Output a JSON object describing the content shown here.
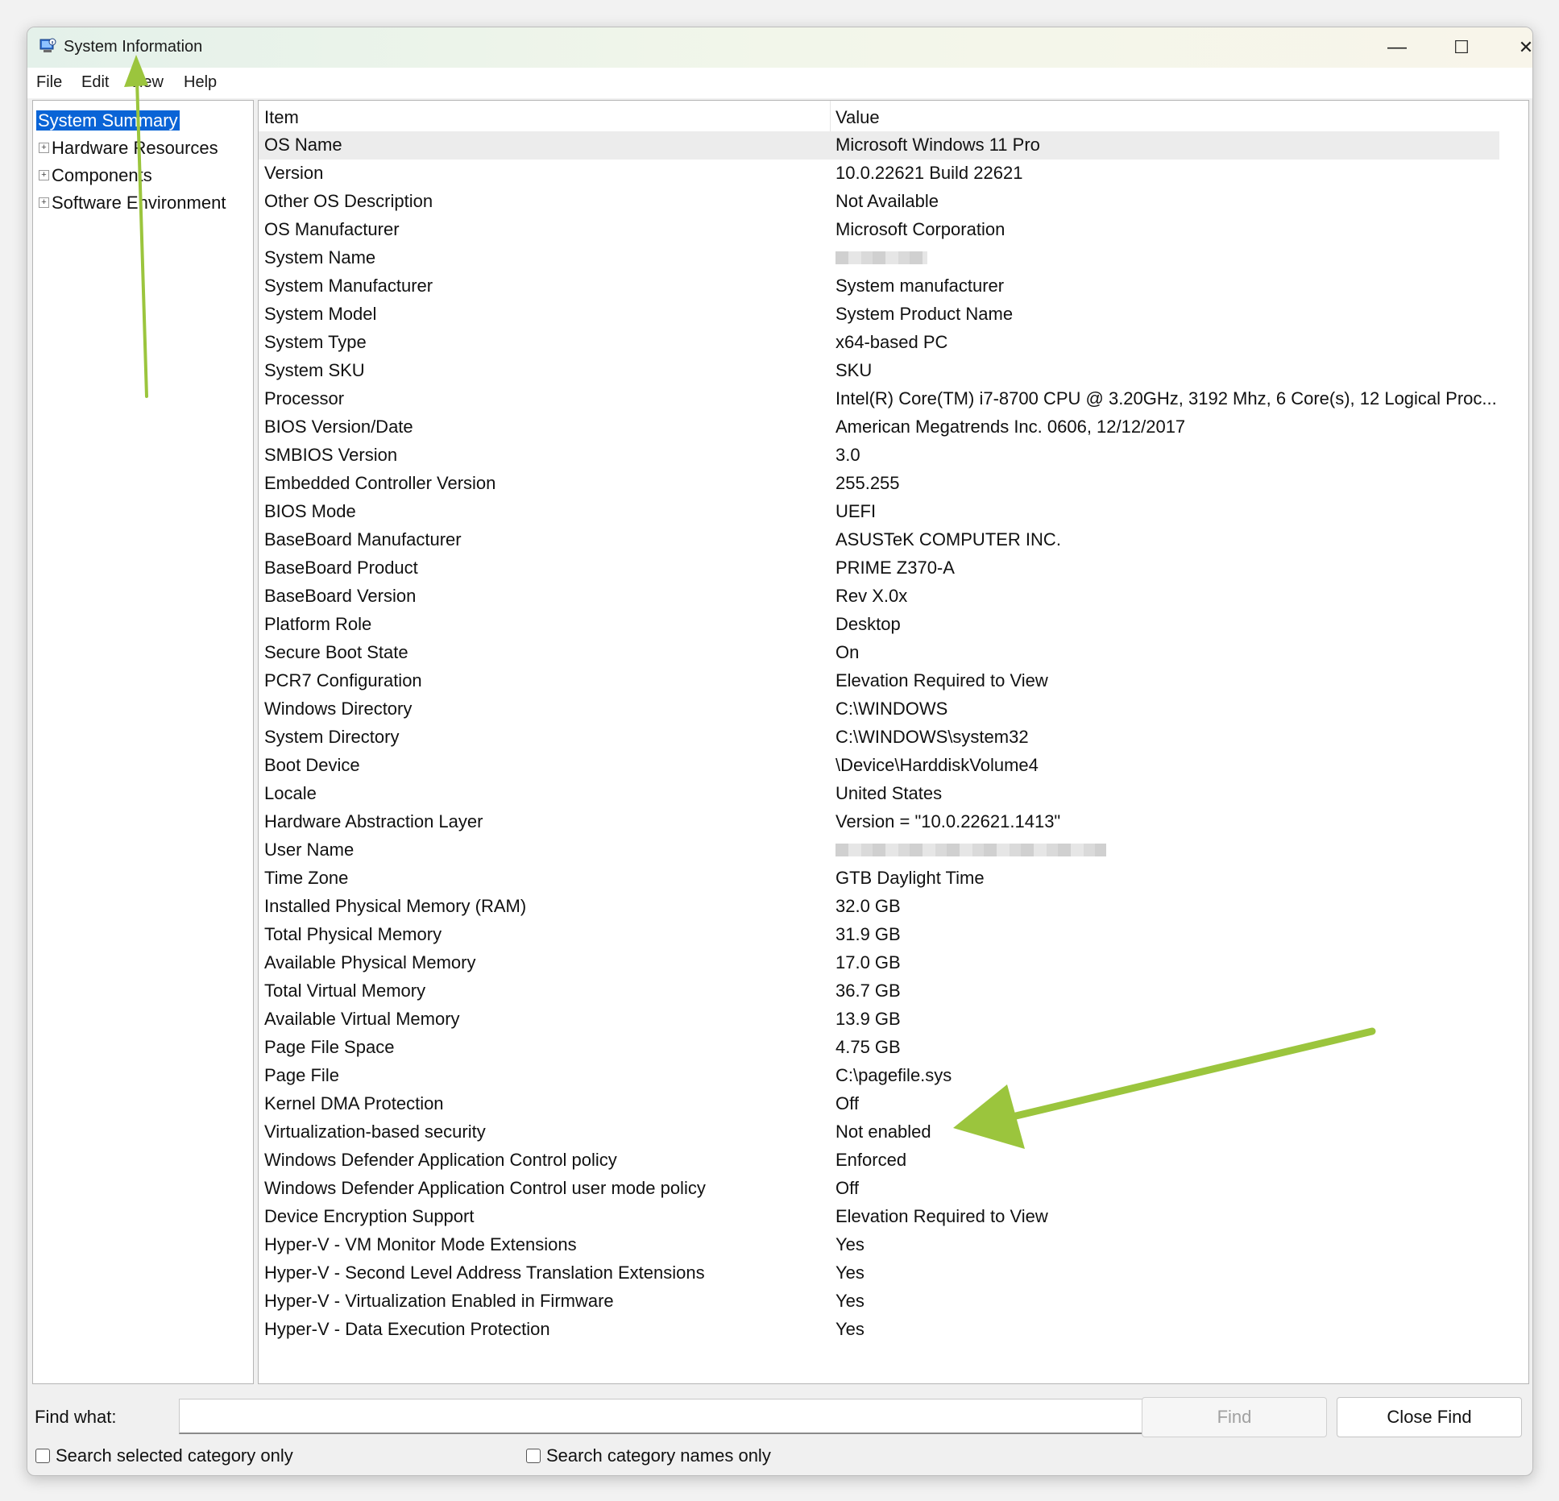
{
  "window": {
    "title": "System Information",
    "minimize_glyph": "—",
    "maximize_glyph": "☐",
    "close_glyph": "✕"
  },
  "menu": [
    "File",
    "Edit",
    "View",
    "Help"
  ],
  "tree": [
    {
      "label": "System Summary",
      "selected": true,
      "expandable": false
    },
    {
      "label": "Hardware Resources",
      "selected": false,
      "expandable": true
    },
    {
      "label": "Components",
      "selected": false,
      "expandable": true
    },
    {
      "label": "Software Environment",
      "selected": false,
      "expandable": true
    }
  ],
  "table": {
    "headers": {
      "item": "Item",
      "value": "Value"
    },
    "rows": [
      {
        "item": "OS Name",
        "value": "Microsoft Windows 11 Pro"
      },
      {
        "item": "Version",
        "value": "10.0.22621 Build 22621"
      },
      {
        "item": "Other OS Description",
        "value": "Not Available"
      },
      {
        "item": "OS Manufacturer",
        "value": "Microsoft Corporation"
      },
      {
        "item": "System Name",
        "value": "",
        "redacted": true
      },
      {
        "item": "System Manufacturer",
        "value": "System manufacturer"
      },
      {
        "item": "System Model",
        "value": "System Product Name"
      },
      {
        "item": "System Type",
        "value": "x64-based PC"
      },
      {
        "item": "System SKU",
        "value": "SKU"
      },
      {
        "item": "Processor",
        "value": "Intel(R) Core(TM) i7-8700 CPU @ 3.20GHz, 3192 Mhz, 6 Core(s), 12 Logical Proc..."
      },
      {
        "item": "BIOS Version/Date",
        "value": "American Megatrends Inc. 0606, 12/12/2017"
      },
      {
        "item": "SMBIOS Version",
        "value": "3.0"
      },
      {
        "item": "Embedded Controller Version",
        "value": "255.255"
      },
      {
        "item": "BIOS Mode",
        "value": "UEFI"
      },
      {
        "item": "BaseBoard Manufacturer",
        "value": "ASUSTeK COMPUTER INC."
      },
      {
        "item": "BaseBoard Product",
        "value": "PRIME Z370-A"
      },
      {
        "item": "BaseBoard Version",
        "value": "Rev X.0x"
      },
      {
        "item": "Platform Role",
        "value": "Desktop"
      },
      {
        "item": "Secure Boot State",
        "value": "On"
      },
      {
        "item": "PCR7 Configuration",
        "value": "Elevation Required to View"
      },
      {
        "item": "Windows Directory",
        "value": "C:\\WINDOWS"
      },
      {
        "item": "System Directory",
        "value": "C:\\WINDOWS\\system32"
      },
      {
        "item": "Boot Device",
        "value": "\\Device\\HarddiskVolume4"
      },
      {
        "item": "Locale",
        "value": "United States"
      },
      {
        "item": "Hardware Abstraction Layer",
        "value": "Version = \"10.0.22621.1413\""
      },
      {
        "item": "User Name",
        "value": "",
        "redacted": true
      },
      {
        "item": "Time Zone",
        "value": "GTB Daylight Time"
      },
      {
        "item": "Installed Physical Memory (RAM)",
        "value": "32.0 GB"
      },
      {
        "item": "Total Physical Memory",
        "value": "31.9 GB"
      },
      {
        "item": "Available Physical Memory",
        "value": "17.0 GB"
      },
      {
        "item": "Total Virtual Memory",
        "value": "36.7 GB"
      },
      {
        "item": "Available Virtual Memory",
        "value": "13.9 GB"
      },
      {
        "item": "Page File Space",
        "value": "4.75 GB"
      },
      {
        "item": "Page File",
        "value": "C:\\pagefile.sys"
      },
      {
        "item": "Kernel DMA Protection",
        "value": "Off"
      },
      {
        "item": "Virtualization-based security",
        "value": "Not enabled"
      },
      {
        "item": "Windows Defender Application Control policy",
        "value": "Enforced"
      },
      {
        "item": "Windows Defender Application Control user mode policy",
        "value": "Off"
      },
      {
        "item": "Device Encryption Support",
        "value": "Elevation Required to View"
      },
      {
        "item": "Hyper-V - VM Monitor Mode Extensions",
        "value": "Yes"
      },
      {
        "item": "Hyper-V - Second Level Address Translation Extensions",
        "value": "Yes"
      },
      {
        "item": "Hyper-V - Virtualization Enabled in Firmware",
        "value": "Yes"
      },
      {
        "item": "Hyper-V - Data Execution Protection",
        "value": "Yes"
      }
    ]
  },
  "find": {
    "label": "Find what:",
    "value": "",
    "find_button": "Find",
    "close_button": "Close Find",
    "check_selected": "Search selected category only",
    "check_names": "Search category names only"
  },
  "colors": {
    "selection": "#0a64d6",
    "annotation_arrow": "#9bc53d"
  }
}
